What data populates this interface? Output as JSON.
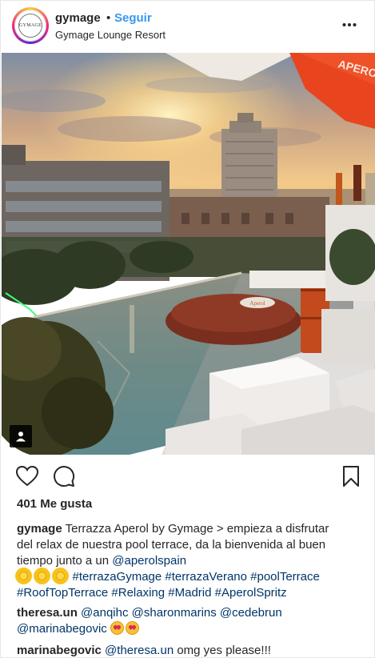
{
  "header": {
    "username": "gymage",
    "separator": "•",
    "follow_label": "Seguir",
    "location": "Gymage Lounge Resort",
    "avatar_text": "GYMAGE"
  },
  "photo": {
    "umbrella_text": "APEROL SPRITZ",
    "cushion_text": "Aperol"
  },
  "actions": {
    "like_icon": "heart-icon",
    "comment_icon": "comment-bubble-icon",
    "save_icon": "bookmark-icon"
  },
  "likes_text": "401 Me gusta",
  "caption": {
    "username": "gymage",
    "line1_text": " Terrazza Aperol by Gymage > empieza a disfrutar",
    "line2_text": "del relax de nuestra pool terrace, da la bienvenida al buen",
    "line3_text": "tiempo junto a un ",
    "line3_mention": "@aperolspain",
    "line4_tags": "#terrazaGymage #terrazaVerano #poolTerrace",
    "line5_tags": "#RoofTopTerrace #Relaxing #Madrid #AperolSpritz"
  },
  "comments": [
    {
      "username": "theresa.un",
      "mention1": "@anqihc",
      "mention2": "@sharonmarins",
      "mention3": "@cedebrun",
      "mention4": "@marinabegovic"
    },
    {
      "username": "marinabegovic",
      "mention": "@theresa.un",
      "text": " omg yes please!!!"
    }
  ],
  "colors": {
    "link_blue": "#3897f0",
    "mention_blue": "#003569",
    "text": "#262626"
  }
}
